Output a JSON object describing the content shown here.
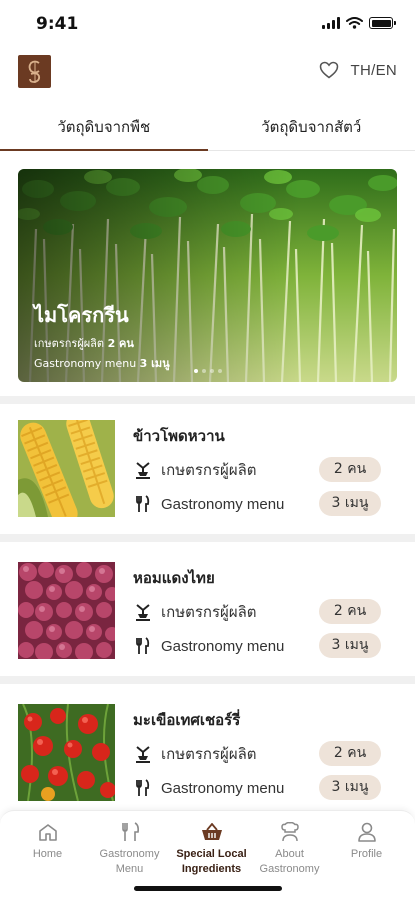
{
  "status": {
    "time": "9:41"
  },
  "header": {
    "logo_icon": "gs-logo-icon",
    "favorite_icon": "heart-icon",
    "lang_label": "TH/EN"
  },
  "tabs": [
    {
      "label": "วัตถุดิบจากพืช",
      "active": true
    },
    {
      "label": "วัตถุดิบจากสัตว์",
      "active": false
    }
  ],
  "hero": {
    "title": "ไมโครกรีน",
    "farmers_label": "เกษตรกรผู้ผลิต",
    "farmers_count": "2 คน",
    "menu_label": "Gastronomy menu",
    "menu_count": "3 เมนู",
    "slides": 4,
    "active_slide": 0
  },
  "items": [
    {
      "name": "ข้าวโพดหวาน",
      "farmers_label": "เกษตรกรผู้ผลิต",
      "farmers_count": "2 คน",
      "menu_label": "Gastronomy menu",
      "menu_count": "3 เมนู",
      "image": "corn"
    },
    {
      "name": "หอมแดงไทย",
      "farmers_label": "เกษตรกรผู้ผลิต",
      "farmers_count": "2 คน",
      "menu_label": "Gastronomy menu",
      "menu_count": "3 เมนู",
      "image": "shallot"
    },
    {
      "name": "มะเขือเทศเชอร์รี่",
      "farmers_label": "เกษตรกรผู้ผลิต",
      "farmers_count": "2 คน",
      "menu_label": "Gastronomy menu",
      "menu_count": "3 เมนู",
      "image": "tomato"
    }
  ],
  "nav": [
    {
      "label": "Home",
      "icon": "home-icon",
      "active": false
    },
    {
      "label": "Gastronomy Menu",
      "icon": "cutlery-icon",
      "active": false
    },
    {
      "label": "Special Local Ingredients",
      "icon": "basket-icon",
      "active": true
    },
    {
      "label": "About Gastronomy",
      "icon": "chef-icon",
      "active": false
    },
    {
      "label": "Profile",
      "icon": "person-icon",
      "active": false
    }
  ],
  "colors": {
    "accent": "#6b3a22",
    "pill_bg": "#eee3d9",
    "divider": "#f0f0f0"
  }
}
